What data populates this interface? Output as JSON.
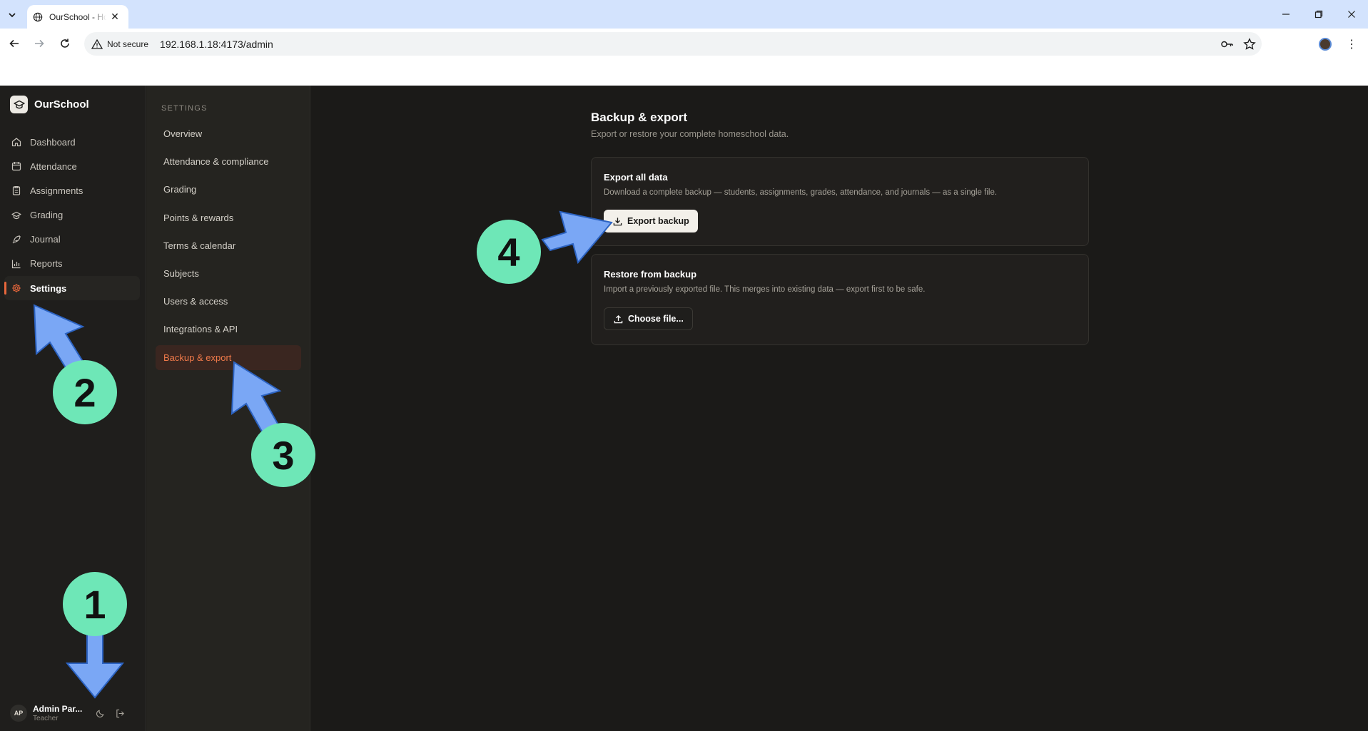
{
  "browser": {
    "tab_title": "OurSchool - Ho",
    "security_label": "Not secure",
    "url": "192.168.1.18:4173/admin"
  },
  "app": {
    "brand": "OurSchool",
    "nav": [
      {
        "label": "Dashboard",
        "icon": "home-icon"
      },
      {
        "label": "Attendance",
        "icon": "calendar-icon"
      },
      {
        "label": "Assignments",
        "icon": "clipboard-icon"
      },
      {
        "label": "Grading",
        "icon": "graduation-cap-icon"
      },
      {
        "label": "Journal",
        "icon": "feather-icon"
      },
      {
        "label": "Reports",
        "icon": "bar-chart-icon"
      },
      {
        "label": "Settings",
        "icon": "gear-icon",
        "active": true
      }
    ],
    "user": {
      "initials": "AP",
      "name": "Admin Par...",
      "role": "Teacher"
    }
  },
  "settings": {
    "heading": "SETTINGS",
    "items": [
      {
        "label": "Overview"
      },
      {
        "label": "Attendance & compliance"
      },
      {
        "label": "Grading"
      },
      {
        "label": "Points & rewards"
      },
      {
        "label": "Terms & calendar"
      },
      {
        "label": "Subjects"
      },
      {
        "label": "Users & access"
      },
      {
        "label": "Integrations & API"
      },
      {
        "label": "Backup & export",
        "active": true
      }
    ]
  },
  "page": {
    "title": "Backup & export",
    "subtitle": "Export or restore your complete homeschool data.",
    "export_card": {
      "title": "Export all data",
      "description": "Download a complete backup — students, assignments, grades, attendance, and journals — as a single file.",
      "button": "Export backup"
    },
    "restore_card": {
      "title": "Restore from backup",
      "description": "Import a previously exported file. This merges into existing data — export first to be safe.",
      "button": "Choose file..."
    }
  },
  "annotations": {
    "step1": "1",
    "step2": "2",
    "step3": "3",
    "step4": "4"
  },
  "colors": {
    "accent": "#e8673c",
    "annotation_circle": "#6ee7b7",
    "annotation_arrow": "#7aa7f5"
  }
}
